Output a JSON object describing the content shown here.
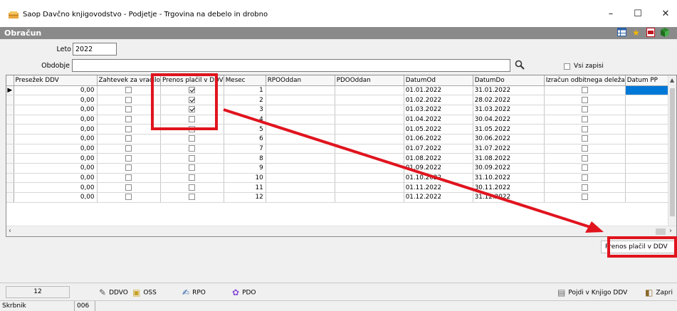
{
  "window": {
    "title": "Saop Davčno knjigovodstvo - Podjetje - Trgovina na debelo in drobno"
  },
  "header": {
    "title": "Obračun"
  },
  "form": {
    "year_label": "Leto",
    "year_value": "2022",
    "period_label": "Obdobje",
    "period_value": "",
    "all_records_label": "Vsi zapisi"
  },
  "grid": {
    "columns": [
      "Presežek DDV",
      "Zahtevek za vračilo",
      "Prenos plačil v DDV",
      "Mesec",
      "RPOOddan",
      "PDOOddan",
      "DatumOd",
      "DatumDo",
      "Izračun odbitnega deleža",
      "Datum PP"
    ],
    "rows": [
      {
        "presezek": "0,00",
        "zahtevek": false,
        "prenos": true,
        "mesec": "1",
        "od": "01.01.2022",
        "do": "31.01.2022",
        "izracun": false
      },
      {
        "presezek": "0,00",
        "zahtevek": false,
        "prenos": true,
        "mesec": "2",
        "od": "01.02.2022",
        "do": "28.02.2022",
        "izracun": false
      },
      {
        "presezek": "0,00",
        "zahtevek": false,
        "prenos": true,
        "mesec": "3",
        "od": "01.03.2022",
        "do": "31.03.2022",
        "izracun": false
      },
      {
        "presezek": "0,00",
        "zahtevek": false,
        "prenos": false,
        "mesec": "4",
        "od": "01.04.2022",
        "do": "30.04.2022",
        "izracun": false
      },
      {
        "presezek": "0,00",
        "zahtevek": false,
        "prenos": false,
        "mesec": "5",
        "od": "01.05.2022",
        "do": "31.05.2022",
        "izracun": false
      },
      {
        "presezek": "0,00",
        "zahtevek": false,
        "prenos": false,
        "mesec": "6",
        "od": "01.06.2022",
        "do": "30.06.2022",
        "izracun": false
      },
      {
        "presezek": "0,00",
        "zahtevek": false,
        "prenos": false,
        "mesec": "7",
        "od": "01.07.2022",
        "do": "31.07.2022",
        "izracun": false
      },
      {
        "presezek": "0,00",
        "zahtevek": false,
        "prenos": false,
        "mesec": "8",
        "od": "01.08.2022",
        "do": "31.08.2022",
        "izracun": false
      },
      {
        "presezek": "0,00",
        "zahtevek": false,
        "prenos": false,
        "mesec": "9",
        "od": "01.09.2022",
        "do": "30.09.2022",
        "izracun": false
      },
      {
        "presezek": "0,00",
        "zahtevek": false,
        "prenos": false,
        "mesec": "10",
        "od": "01.10.2022",
        "do": "31.10.2022",
        "izracun": false
      },
      {
        "presezek": "0,00",
        "zahtevek": false,
        "prenos": false,
        "mesec": "11",
        "od": "01.11.2022",
        "do": "30.11.2022",
        "izracun": false
      },
      {
        "presezek": "0,00",
        "zahtevek": false,
        "prenos": false,
        "mesec": "12",
        "od": "01.12.2022",
        "do": "31.12.2022",
        "izracun": false
      }
    ]
  },
  "popup": {
    "label": "Prenos plačil v DDV"
  },
  "toolbar": {
    "record_count": "12",
    "ddvo": "DDVO",
    "oss": "OSS",
    "rpo": "RPO",
    "pdo": "PDO",
    "to_book": "Pojdi v Knjigo DDV",
    "close": "Zapri"
  },
  "status": {
    "label": "Skrbnik",
    "value": "006"
  },
  "colors": {
    "accent": "#e0141e",
    "selection": "#0078d7",
    "header_bg": "#8a8a8a"
  },
  "icons": [
    "app-icon",
    "minimize-icon",
    "maximize-icon",
    "close-icon",
    "grid-icon",
    "star-icon",
    "pdf-icon",
    "exit-icon",
    "search-icon"
  ]
}
